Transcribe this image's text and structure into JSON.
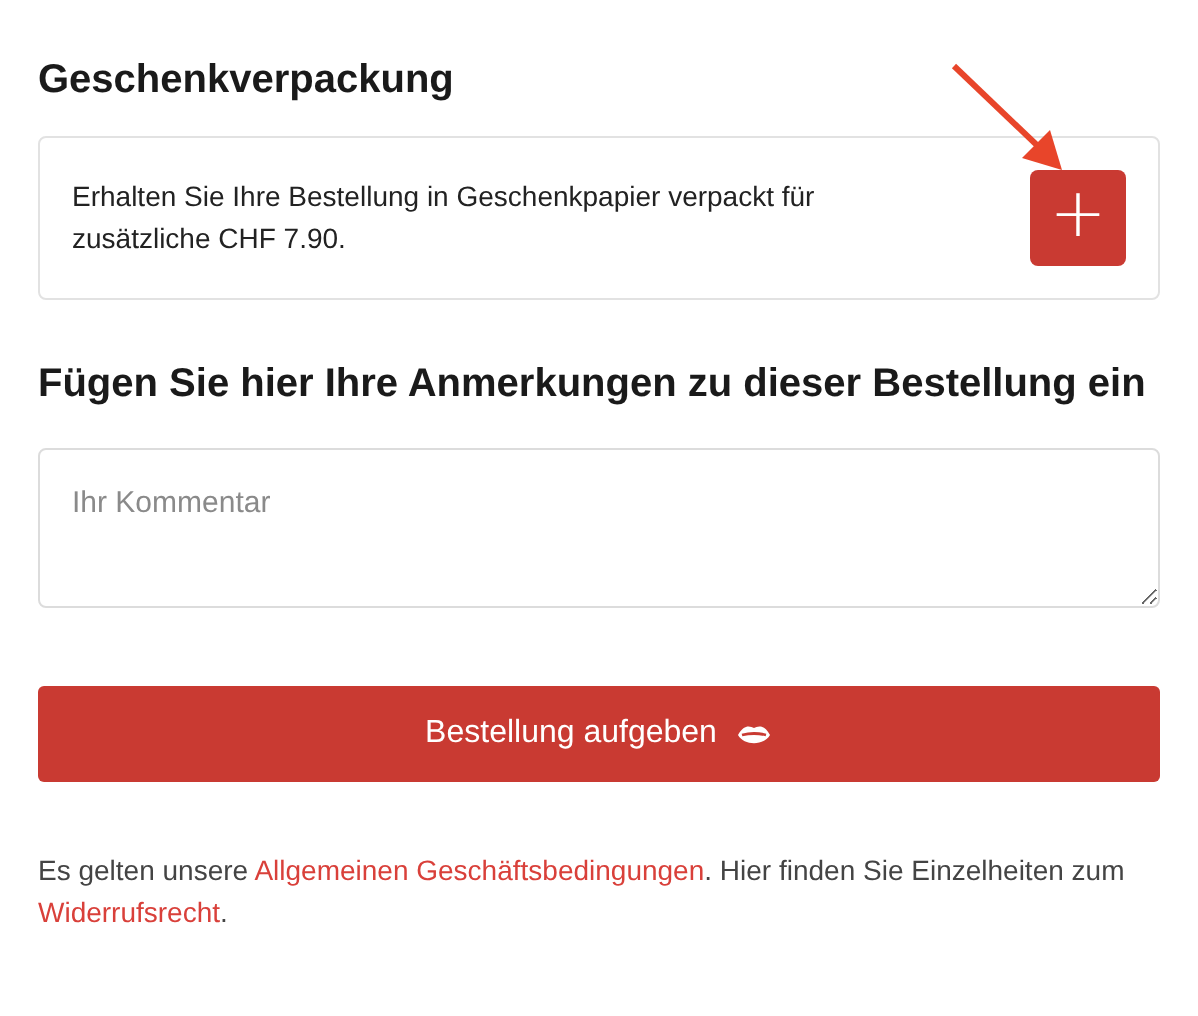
{
  "gift_wrap": {
    "title": "Geschenkverpackung",
    "description": "Erhalten Sie Ihre Bestellung in Geschenkpapier verpackt für zusätzliche CHF 7.90.",
    "add_button": {
      "label": "+"
    }
  },
  "notes": {
    "title": "Fügen Sie hier Ihre Anmerkungen zu dieser Bestellung ein",
    "placeholder": "Ihr Kommentar"
  },
  "submit_button": {
    "label": "Bestellung aufgeben"
  },
  "legal": [
    {
      "kind": "text",
      "text": "Es gelten unsere "
    },
    {
      "kind": "link",
      "text": "Allgemeinen Geschäftsbedingungen"
    },
    {
      "kind": "text",
      "text": ". Hier finden Sie Einzelheiten zum "
    },
    {
      "kind": "link",
      "text": "Widerrufsrecht"
    },
    {
      "kind": "text",
      "text": "."
    }
  ]
}
